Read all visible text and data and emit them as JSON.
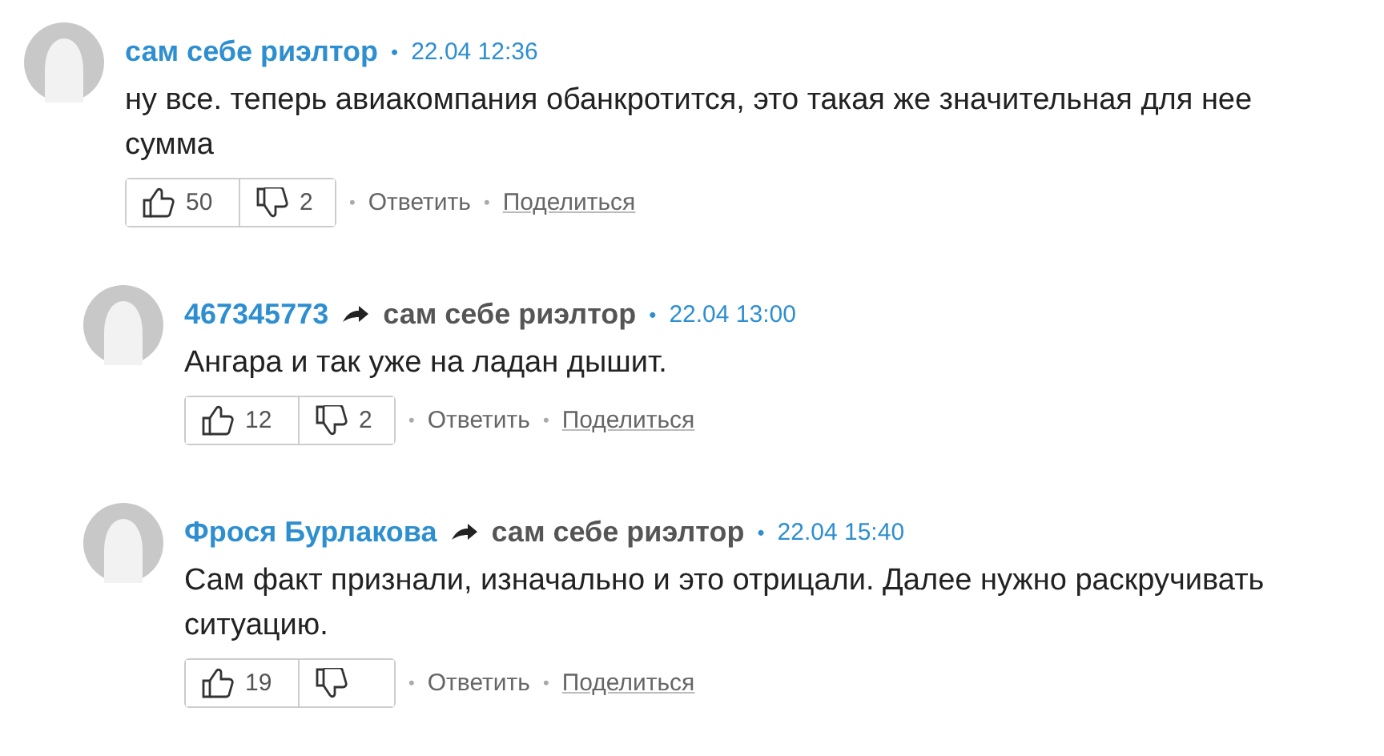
{
  "comments": [
    {
      "author": "сам себе риэлтор",
      "separator": "•",
      "time": "22.04 12:36",
      "text": "ну все. теперь авиакомпания обанкротится, это такая же значительная для нее сумма",
      "likes": "50",
      "dislikes": "2",
      "reply": "Ответить",
      "share": "Поделиться",
      "children": [
        {
          "author": "467345773",
          "reply_to": "сам себе риэлтор",
          "separator": "•",
          "time": "22.04 13:00",
          "text": "Ангара и так уже на ладан дышит.",
          "likes": "12",
          "dislikes": "2",
          "reply": "Ответить",
          "share": "Поделиться"
        },
        {
          "author": "Фрося Бурлакова",
          "reply_to": "сам себе риэлтор",
          "separator": "•",
          "time": "22.04 15:40",
          "text": "Сам факт признали, изначально и это отрицали. Далее нужно раскручивать ситуацию.",
          "likes": "19",
          "reply": "Ответить",
          "share": "Поделиться"
        }
      ]
    }
  ]
}
